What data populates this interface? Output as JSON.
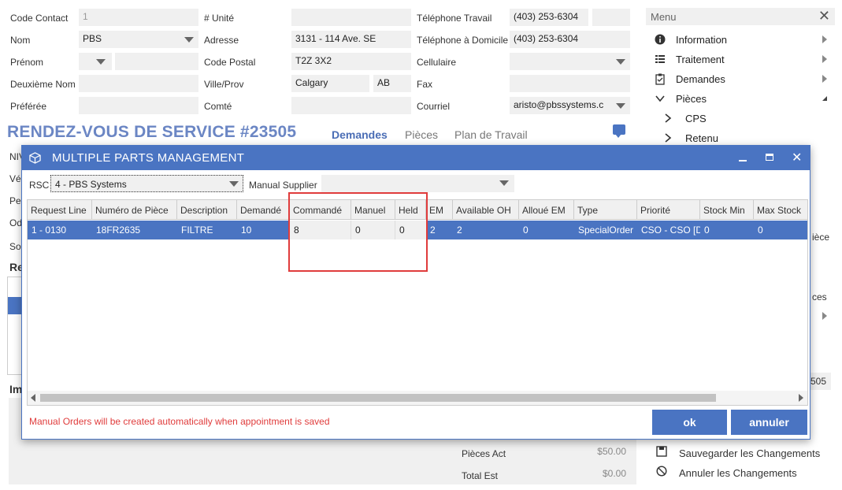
{
  "form": {
    "code_contact_label": "Code Contact",
    "code_contact_value": "1",
    "nom_label": "Nom",
    "nom_value": "PBS",
    "prenom_label": "Prénom",
    "deuxieme_nom_label": "Deuxième Nom",
    "preferee_label": "Préférée",
    "unite_label": "# Unité",
    "adresse_label": "Adresse",
    "adresse_value": "3131 - 114 Ave. SE",
    "code_postal_label": "Code Postal",
    "code_postal_value": "T2Z 3X2",
    "ville_label": "Ville/Prov",
    "ville_value": "Calgary",
    "prov_value": "AB",
    "comte_label": "Comté",
    "tel_travail_label": "Téléphone Travail",
    "tel_travail_value": "(403) 253-6304",
    "tel_domicile_label": "Téléphone à Domicile",
    "tel_domicile_value": "(403) 253-6304",
    "cellulaire_label": "Cellulaire",
    "fax_label": "Fax",
    "courriel_label": "Courriel",
    "courriel_value": "aristo@pbssystems.c"
  },
  "appointment": {
    "title": "RENDEZ-VOUS DE SERVICE #23505",
    "tabs": [
      "Demandes",
      "Pièces",
      "Plan de Travail"
    ],
    "left_fragments": [
      "NIV",
      "Véh",
      "Per",
      "Od",
      "Sou",
      "Re",
      "Im"
    ],
    "right_fragments": [
      "ièce",
      "ces",
      "505"
    ]
  },
  "menu": {
    "title": "Menu",
    "items": [
      {
        "label": "Information",
        "icon": "info-icon"
      },
      {
        "label": "Traitement",
        "icon": "list-icon"
      },
      {
        "label": "Demandes",
        "icon": "clipboard-icon"
      },
      {
        "label": "Pièces",
        "icon": "chevron-down-icon"
      },
      {
        "label": "CPS",
        "icon": "chevron-right-icon"
      },
      {
        "label": "Retenu",
        "icon": "chevron-right-icon"
      }
    ]
  },
  "totals": {
    "pieces_act_label": "Pièces Act",
    "pieces_act_value": "$50.00",
    "total_est_label": "Total Est",
    "total_est_value": "$0.00"
  },
  "actions": {
    "save_label": "Sauvegarder les Changements",
    "cancel_label": "Annuler les Changements"
  },
  "dialog": {
    "title": "MULTIPLE PARTS MANAGEMENT",
    "rsc_label": "RSC",
    "rsc_value": "4 - PBS Systems",
    "manual_supplier_label": "Manual Supplier",
    "columns": [
      "Request Line",
      "Numéro de Pièce",
      "Description",
      "Demandé",
      "Commandé",
      "Manuel",
      "Held",
      "EM",
      "Available OH",
      "Alloué EM",
      "Type",
      "Priorité",
      "Stock Min",
      "Max Stock"
    ],
    "rows": [
      [
        "1 - 0130",
        "18FR2635",
        "FILTRE",
        "10",
        "8",
        "0",
        "0",
        "2",
        "2",
        "0",
        "SpecialOrder",
        "CSO - CSO [D]",
        "0",
        "0"
      ]
    ],
    "note": "Manual Orders will be created automatically when appointment is saved",
    "ok_label": "ok",
    "cancel_label": "annuler"
  },
  "colors": {
    "accent": "#4a74c2",
    "row_selected": "#4a74c2",
    "highlight_box": "#e03c3c",
    "note_text": "#e03c3c"
  }
}
